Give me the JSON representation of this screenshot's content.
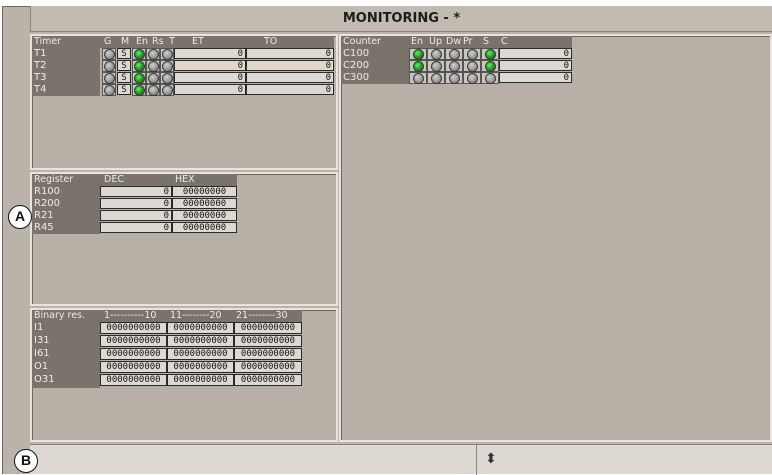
{
  "window": {
    "title": "MONITORING - *"
  },
  "callouts": {
    "a": "A",
    "b": "B"
  },
  "timers": {
    "headers": {
      "name": "Timer",
      "g": "G",
      "m": "M",
      "en": "En",
      "rs": "Rs",
      "t": "T",
      "et": "ET",
      "to": "TO"
    },
    "rows": [
      {
        "name": "T1",
        "m": "S",
        "et": "0",
        "to": "0",
        "en": true
      },
      {
        "name": "T2",
        "m": "S",
        "et": "0",
        "to": "0",
        "en": true
      },
      {
        "name": "T3",
        "m": "S",
        "et": "0",
        "to": "0",
        "en": true
      },
      {
        "name": "T4",
        "m": "S",
        "et": "0",
        "to": "0",
        "en": true
      }
    ]
  },
  "counters": {
    "headers": {
      "name": "Counter",
      "en": "En",
      "up": "Up",
      "dw": "Dw",
      "pr": "Pr",
      "s": "S",
      "c": "C"
    },
    "rows": [
      {
        "name": "C100",
        "c": "0",
        "en": true,
        "s": true
      },
      {
        "name": "C200",
        "c": "0",
        "en": true,
        "s": true
      },
      {
        "name": "C300",
        "c": "0",
        "en": false,
        "s": false
      }
    ]
  },
  "registers": {
    "headers": {
      "name": "Register",
      "dec": "DEC",
      "hex": "HEX"
    },
    "rows": [
      {
        "name": "R100",
        "dec": "0",
        "hex": "00000000"
      },
      {
        "name": "R200",
        "dec": "0",
        "hex": "00000000"
      },
      {
        "name": "R21",
        "dec": "0",
        "hex": "00000000"
      },
      {
        "name": "R45",
        "dec": "0",
        "hex": "00000000"
      }
    ]
  },
  "binary": {
    "headers": {
      "name": "Binary res.",
      "c1": "1----------10",
      "c2": "11--------20",
      "c3": "21--------30"
    },
    "rows": [
      {
        "name": "I1",
        "b1": "0000000000",
        "b2": "0000000000",
        "b3": "0000000000"
      },
      {
        "name": "I31",
        "b1": "0000000000",
        "b2": "0000000000",
        "b3": "0000000000"
      },
      {
        "name": "I61",
        "b1": "0000000000",
        "b2": "0000000000",
        "b3": "0000000000"
      },
      {
        "name": "O1",
        "b1": "0000000000",
        "b2": "0000000000",
        "b3": "0000000000"
      },
      {
        "name": "O31",
        "b1": "0000000000",
        "b2": "0000000000",
        "b3": "0000000000"
      }
    ]
  },
  "statusbar": {
    "text": ""
  }
}
